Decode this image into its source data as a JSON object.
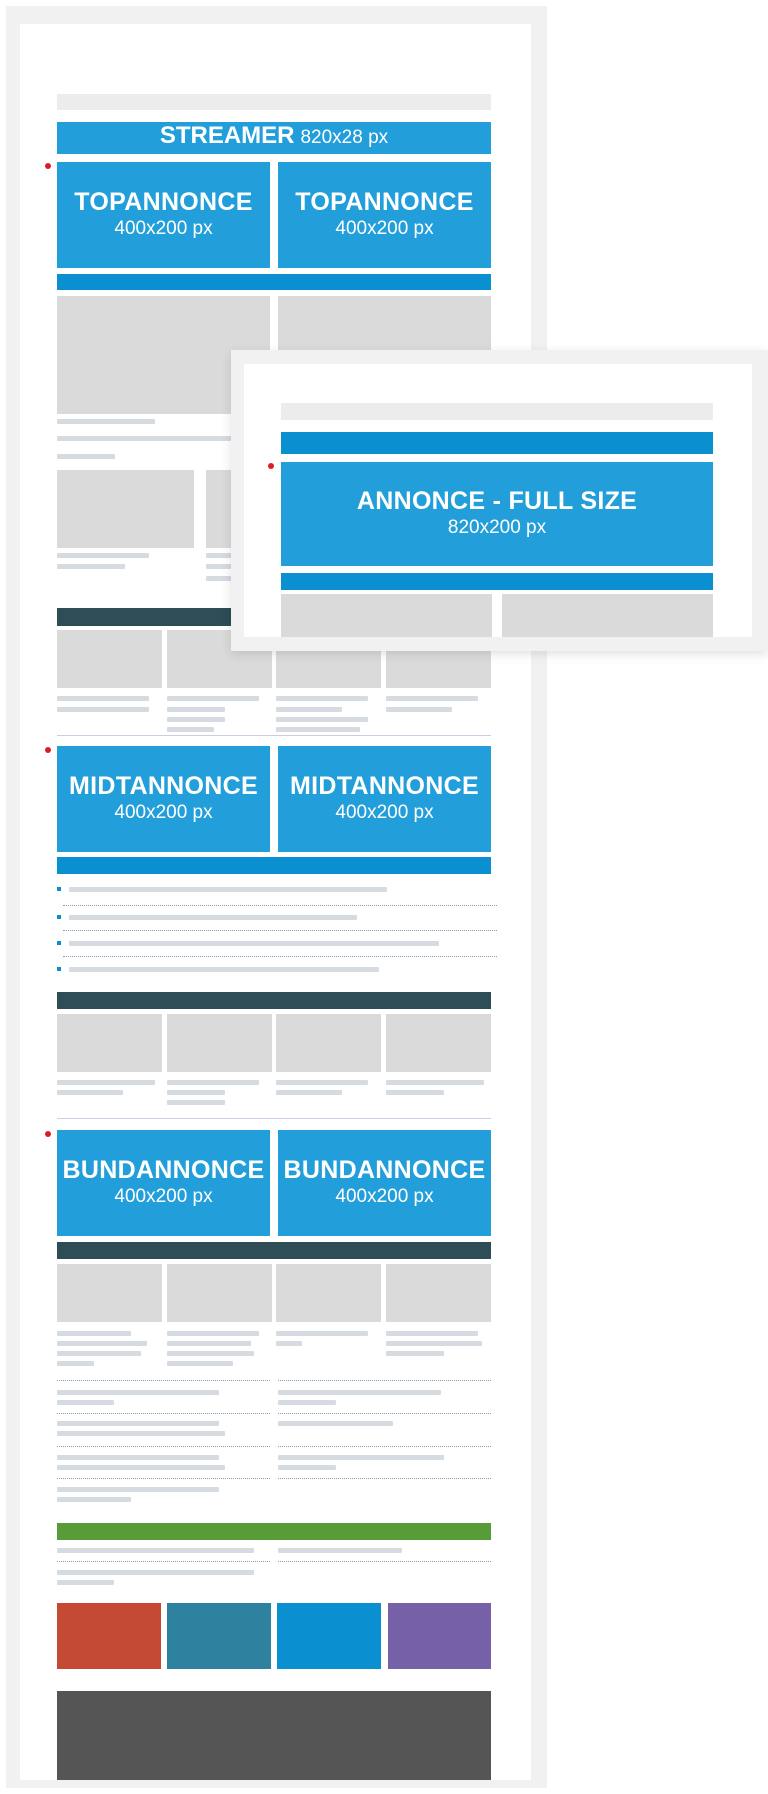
{
  "streamer": {
    "title": "STREAMER",
    "size": "820x28 px"
  },
  "top_ads": [
    {
      "title": "TOPANNONCE",
      "size": "400x200 px"
    },
    {
      "title": "TOPANNONCE",
      "size": "400x200 px"
    }
  ],
  "full_size_ad": {
    "title": "ANNONCE - FULL SIZE",
    "size": "820x200 px"
  },
  "mid_ads": [
    {
      "title": "MIDTANNONCE",
      "size": "400x200 px"
    },
    {
      "title": "MIDTANNONCE",
      "size": "400x200 px"
    }
  ],
  "bottom_ads": [
    {
      "title": "BUNDANNONCE",
      "size": "400x200 px"
    },
    {
      "title": "BUNDANNONCE",
      "size": "400x200 px"
    }
  ],
  "colors": {
    "ad_blue": "#229fda",
    "bar_blue": "#0a8fd0",
    "section_dark": "#2e4d57",
    "placeholder_gray": "#dadada",
    "marker_red": "#d91e2a",
    "green_bar": "#579c36",
    "tile_red": "#c44a34",
    "tile_teal": "#2e82a0",
    "tile_blue": "#0a8fd0",
    "tile_purple": "#7660a8",
    "footer_gray": "#555555"
  }
}
